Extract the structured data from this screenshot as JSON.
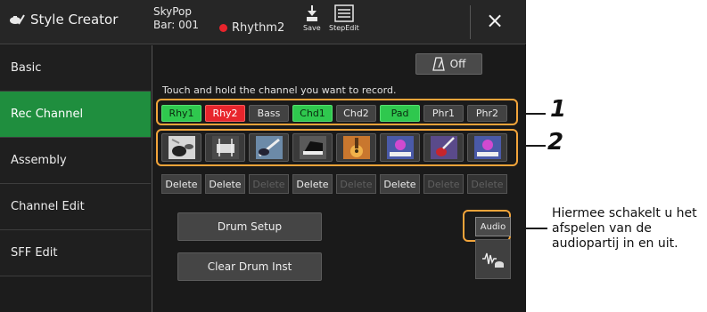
{
  "header": {
    "title": "Style Creator",
    "style_name": "SkyPop",
    "bar": "Bar: 001",
    "rec_channel": "Rhythm2",
    "save_label": "Save",
    "stepedit_label": "StepEdit",
    "close_label": "×"
  },
  "sidebar": {
    "items": [
      {
        "label": "Basic"
      },
      {
        "label": "Rec Channel"
      },
      {
        "label": "Assembly"
      },
      {
        "label": "Channel Edit"
      },
      {
        "label": "SFF Edit"
      }
    ]
  },
  "main": {
    "metronome_label": "Off",
    "hint": "Touch and hold the channel you want to record.",
    "channels": [
      {
        "label": "Rhy1",
        "state": "green"
      },
      {
        "label": "Rhy2",
        "state": "red"
      },
      {
        "label": "Bass",
        "state": "off"
      },
      {
        "label": "Chd1",
        "state": "green"
      },
      {
        "label": "Chd2",
        "state": "off"
      },
      {
        "label": "Pad",
        "state": "green"
      },
      {
        "label": "Phr1",
        "state": "off"
      },
      {
        "label": "Phr2",
        "state": "off"
      }
    ],
    "instruments": [
      "drum-kit-icon",
      "drum-kit-icon",
      "electric-bass-icon",
      "piano-icon",
      "acoustic-guitar-icon",
      "synth-pad-icon",
      "electric-guitar-icon",
      "synth-pad-icon"
    ],
    "delete": [
      {
        "label": "Delete",
        "enabled": true
      },
      {
        "label": "Delete",
        "enabled": true
      },
      {
        "label": "Delete",
        "enabled": false
      },
      {
        "label": "Delete",
        "enabled": true
      },
      {
        "label": "Delete",
        "enabled": false
      },
      {
        "label": "Delete",
        "enabled": true
      },
      {
        "label": "Delete",
        "enabled": false
      },
      {
        "label": "Delete",
        "enabled": false
      }
    ],
    "drum_setup_label": "Drum Setup",
    "clear_drum_label": "Clear Drum Inst",
    "audio_label": "Audio"
  },
  "callouts": {
    "num1": "1",
    "num2": "2",
    "note": "Hiermee schakelt u het afspelen van de audiopartij in en uit."
  },
  "colors": {
    "accent_green": "#1f8e3e",
    "channel_green": "#2fc84e",
    "record_red": "#e8252c",
    "highlight_orange": "#f2a43a"
  }
}
